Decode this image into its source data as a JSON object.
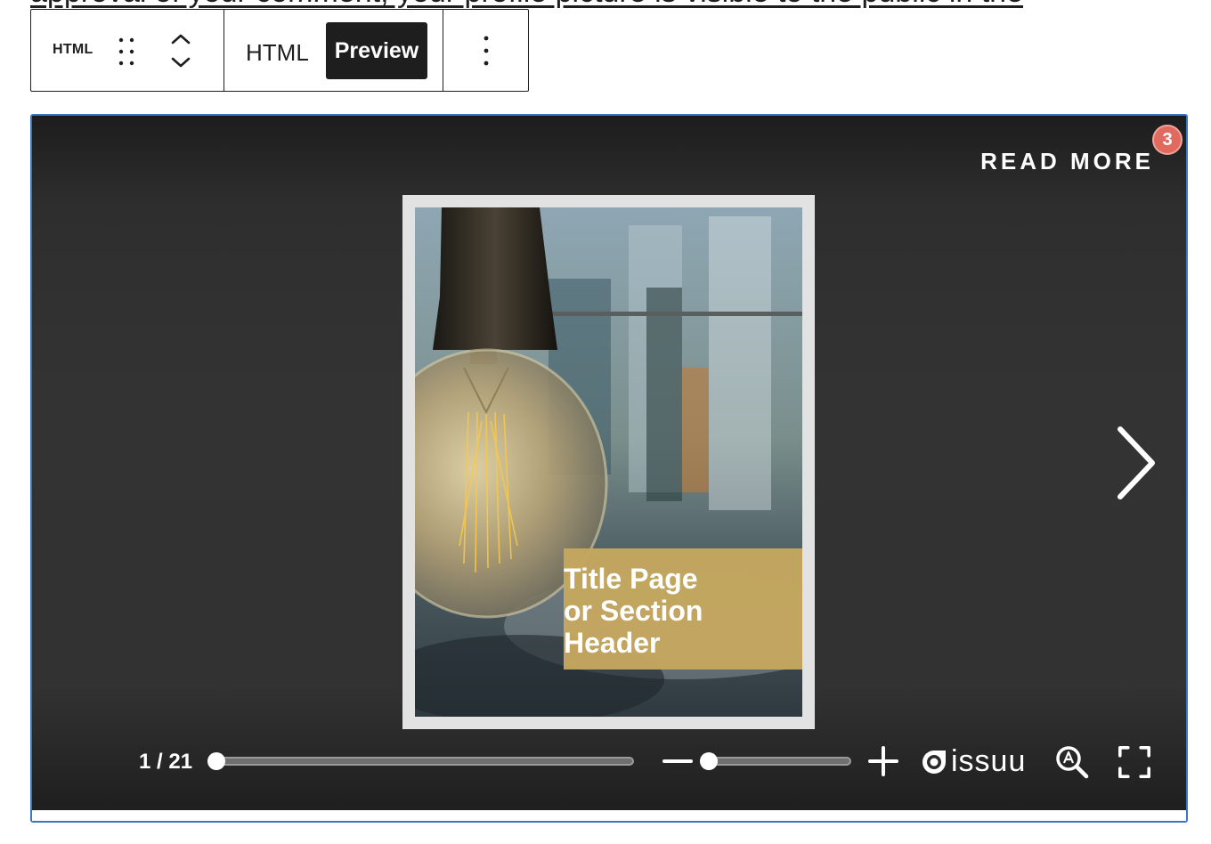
{
  "background_text": "approval of your comment, your profile picture is visible to the public in the",
  "toolbar": {
    "block_type": "HTML",
    "html_tab": "HTML",
    "preview_tab": "Preview"
  },
  "viewer": {
    "read_more": "READ MORE",
    "badge_count": "3",
    "page_title": "Title Page\nor Section\nHeader",
    "page_indicator": "1 / 21",
    "brand": "issuu",
    "page_progress": 0.0,
    "zoom_level": 0.0
  },
  "colors": {
    "viewer_bg": "#333333",
    "title_box": "#c5a85f",
    "badge": "#e06a5e",
    "selection_border": "#3a76c4",
    "toolbar_active": "#1e1e1e"
  }
}
